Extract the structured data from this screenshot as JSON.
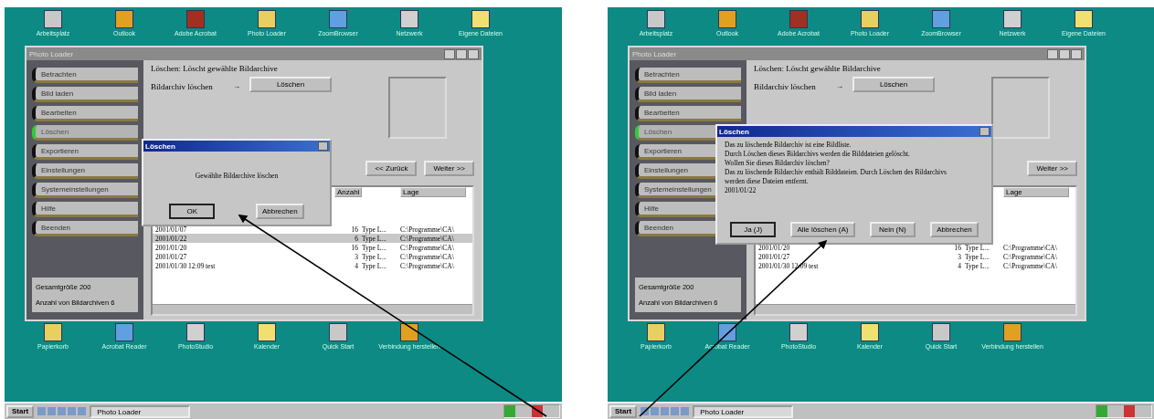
{
  "screens": [
    {
      "desktop_icons_top": [
        "Arbeitsplatz",
        "Outlook",
        "Adobe Acrobat",
        "Photo Loader",
        "ZoomBrowser",
        "Netzwerk",
        "Eigene Dateien"
      ],
      "desktop_icons_bottom": [
        "Papierkorb",
        "Acrobat Reader",
        "PhotoStudio",
        "Kalender",
        "Quick Start",
        "Verbindung herstellen"
      ],
      "window": {
        "title": "Photo Loader",
        "header": "Löschen: Löscht gewählte Bildarchive",
        "field_label": "Bildarchiv löschen",
        "field_arrow": "→",
        "field_button": "Löschen",
        "sidebar": [
          {
            "label": "Betrachten",
            "selected": false
          },
          {
            "label": "Bild laden",
            "selected": false
          },
          {
            "label": "Bearbeiten",
            "selected": false
          },
          {
            "label": "Löschen",
            "selected": true
          },
          {
            "label": "Exportieren",
            "selected": false
          },
          {
            "label": "Einstellungen",
            "selected": false
          },
          {
            "label": "Systemeinstellungen",
            "selected": false
          },
          {
            "label": "Hilfe",
            "selected": false
          },
          {
            "label": "Beenden",
            "selected": false
          }
        ],
        "info": [
          "Gesamtgröße 200",
          "Anzahl von Bildarchiven 6"
        ],
        "nav": [
          "<< Zurück",
          "Weiter >>"
        ],
        "table": {
          "columns": [
            "",
            "Anzahl",
            "",
            "Lage"
          ],
          "rows": [
            {
              "cells": [
                "2001/01/07",
                "16",
                "Type L...",
                "C:\\Programme\\CA\\"
              ],
              "selected": false
            },
            {
              "cells": [
                "2001/01/22",
                "6",
                "Type L...",
                "C:\\Programme\\CA\\"
              ],
              "selected": true
            },
            {
              "cells": [
                "2001/01/20",
                "16",
                "Type L...",
                "C:\\Programme\\CA\\"
              ],
              "selected": false
            },
            {
              "cells": [
                "2001/01/27",
                "3",
                "Type L...",
                "C:\\Programme\\CA\\"
              ],
              "selected": false
            },
            {
              "cells": [
                "2001/01/30 12:09   test",
                "4",
                "Type L...",
                "C:\\Programme\\CA\\"
              ],
              "selected": false
            }
          ]
        }
      },
      "dialog": {
        "kind": "short",
        "title": "Löschen",
        "lines": [
          "Gewählte Bildarchive löschen"
        ],
        "buttons": [
          {
            "label": "OK",
            "focused": true
          },
          {
            "label": "Abbrechen",
            "focused": false
          }
        ]
      },
      "taskbar": {
        "start": "Start",
        "task": "Photo Loader"
      }
    },
    {
      "desktop_icons_top": [
        "Arbeitsplatz",
        "Outlook",
        "Adobe Acrobat",
        "Photo Loader",
        "ZoomBrowser",
        "Netzwerk",
        "Eigene Dateien"
      ],
      "desktop_icons_bottom": [
        "Papierkorb",
        "Acrobat Reader",
        "PhotoStudio",
        "Kalender",
        "Quick Start",
        "Verbindung herstellen"
      ],
      "window": {
        "title": "Photo Loader",
        "header": "Löschen: Löscht gewählte Bildarchive",
        "field_label": "Bildarchiv löschen",
        "field_arrow": "→",
        "field_button": "Löschen",
        "sidebar": [
          {
            "label": "Betrachten",
            "selected": false
          },
          {
            "label": "Bild laden",
            "selected": false
          },
          {
            "label": "Bearbeiten",
            "selected": false
          },
          {
            "label": "Löschen",
            "selected": true
          },
          {
            "label": "Exportieren",
            "selected": false
          },
          {
            "label": "Einstellungen",
            "selected": false
          },
          {
            "label": "Systemeinstellungen",
            "selected": false
          },
          {
            "label": "Hilfe",
            "selected": false
          },
          {
            "label": "Beenden",
            "selected": false
          }
        ],
        "info": [
          "Gesamtgröße 200",
          "Anzahl von Bildarchiven 6"
        ],
        "nav": [
          "Weiter >>"
        ],
        "table": {
          "columns": [
            "",
            "",
            "",
            "Lage"
          ],
          "rows": [
            {
              "cells": [
                "2001/01/20",
                "16",
                "Type L...",
                "C:\\Programme\\CA\\"
              ],
              "selected": false
            },
            {
              "cells": [
                "2001/01/27",
                "3",
                "Type L...",
                "C:\\Programme\\CA\\"
              ],
              "selected": false
            },
            {
              "cells": [
                "2001/01/30 12:09   test",
                "4",
                "Type L...",
                "C:\\Programme\\CA\\"
              ],
              "selected": false
            }
          ]
        }
      },
      "dialog": {
        "kind": "long",
        "title": "Löschen",
        "lines": [
          "Das zu löschende Bildarchiv ist eine Bildliste.",
          "Durch Löschen dieses Bildarchivs werden die Bilddateien gelöscht.",
          "Wollen Sie dieses Bildarchiv löschen?",
          "Das zu löschende Bildarchiv enthält Bilddateien. Durch Löschen des Bildarchivs",
          "werden diese Dateien entfernt.",
          "2001/01/22"
        ],
        "buttons": [
          {
            "label": "Ja (J)",
            "focused": true
          },
          {
            "label": "Alle löschen (A)",
            "focused": false
          },
          {
            "label": "Nein (N)",
            "focused": false
          },
          {
            "label": "Abbrechen",
            "focused": false
          }
        ]
      },
      "taskbar": {
        "start": "Start",
        "task": "Photo Loader"
      }
    }
  ]
}
